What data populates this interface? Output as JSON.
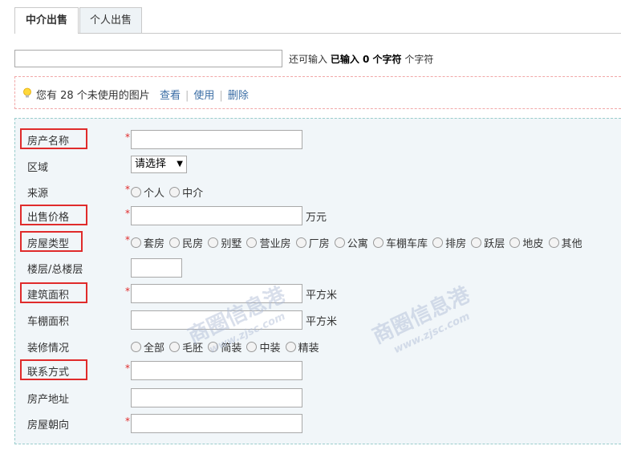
{
  "tabs": [
    {
      "label": "中介出售",
      "active": true
    },
    {
      "label": "个人出售",
      "active": false
    }
  ],
  "title_counter": {
    "prefix": "还可输入",
    "typed": "已输入 0 个字符",
    "suffix": "个字符"
  },
  "notice": {
    "text": "您有 28 个未使用的图片",
    "links": [
      "查看",
      "使用",
      "删除"
    ]
  },
  "form": {
    "house_name": {
      "label": "房产名称",
      "required": true
    },
    "district": {
      "label": "区域",
      "selected": "请选择"
    },
    "source": {
      "label": "来源",
      "required": true,
      "options": [
        "个人",
        "中介"
      ]
    },
    "price": {
      "label": "出售价格",
      "required": true,
      "unit": "万元"
    },
    "house_type": {
      "label": "房屋类型",
      "required": true,
      "options": [
        "套房",
        "民房",
        "别墅",
        "营业房",
        "厂房",
        "公寓",
        "车棚车库",
        "排房",
        "跃层",
        "地皮",
        "其他"
      ]
    },
    "floor": {
      "label": "楼层/总楼层"
    },
    "area": {
      "label": "建筑面积",
      "required": true,
      "unit": "平方米"
    },
    "garage_area": {
      "label": "车棚面积",
      "unit": "平方米"
    },
    "decoration": {
      "label": "装修情况",
      "options": [
        "全部",
        "毛胚",
        "简装",
        "中装",
        "精装"
      ]
    },
    "contact": {
      "label": "联系方式",
      "required": true
    },
    "address": {
      "label": "房产地址"
    },
    "orientation": {
      "label": "房屋朝向",
      "required": true
    }
  },
  "watermark": {
    "brand": "商圈信息港",
    "site": "www.zjsc.com"
  },
  "colors": {
    "highlight_box": "#e02b2b",
    "link": "#3b6ea5",
    "form_bg": "#f1f6f9"
  }
}
